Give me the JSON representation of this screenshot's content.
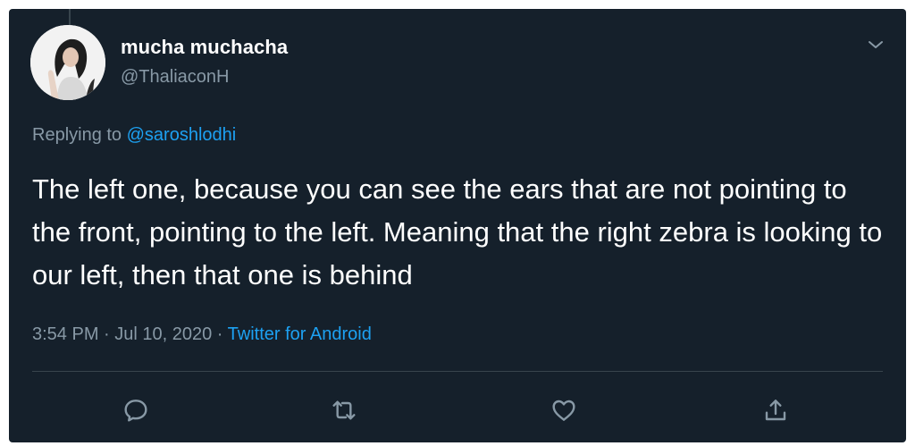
{
  "tweet": {
    "display_name": "mucha muchacha",
    "handle": "@ThaliaconH",
    "replying_prefix": "Replying to ",
    "replying_to": "@saroshlodhi",
    "text": "The left one, because you can see the ears that are not pointing to the front, pointing to the left. Meaning that the right zebra is looking to our left, then that one is behind",
    "time": "3:54 PM",
    "separator1": " · ",
    "date": "Jul 10, 2020",
    "separator2": " · ",
    "source": "Twitter for Android"
  },
  "icons": {
    "more": "chevron-down-icon",
    "reply": "reply-icon",
    "retweet": "retweet-icon",
    "like": "heart-icon",
    "share": "share-icon"
  },
  "colors": {
    "background": "#15202b",
    "text": "#ffffff",
    "muted": "#8899a6",
    "link": "#1da1f2",
    "divider": "#38444d"
  }
}
